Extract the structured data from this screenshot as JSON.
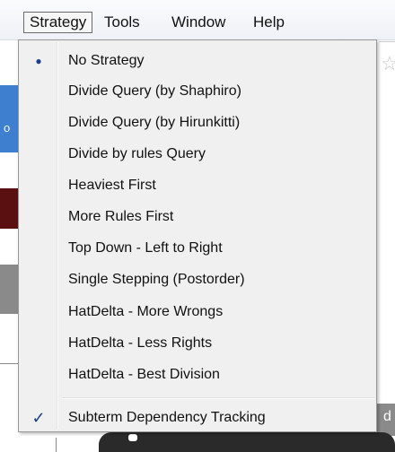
{
  "menubar": {
    "items": [
      {
        "label": "Strategy"
      },
      {
        "label": "Tools"
      },
      {
        "label": "Window"
      },
      {
        "label": "Help"
      }
    ]
  },
  "background": {
    "left_fragment_text": "o",
    "right_fragment_text": "d"
  },
  "strategy_menu": {
    "items": [
      {
        "label": "No Strategy",
        "state": "radio-selected",
        "icon": "bullet-icon",
        "glyph": "●"
      },
      {
        "label": "Divide  Query (by Shaphiro)"
      },
      {
        "label": "Divide  Query (by Hirunkitti)"
      },
      {
        "label": "Divide by rules  Query"
      },
      {
        "label": "Heaviest First"
      },
      {
        "label": "More Rules First"
      },
      {
        "label": "Top Down - Left to Right"
      },
      {
        "label": "Single Stepping (Postorder)"
      },
      {
        "label": "HatDelta - More Wrongs"
      },
      {
        "label": "HatDelta - Less Rights"
      },
      {
        "label": "HatDelta - Best Division"
      },
      {
        "label": "Subterm Dependency Tracking",
        "state": "checked",
        "icon": "check-icon",
        "glyph": "✓"
      }
    ]
  },
  "colors": {
    "menu_background": "#f0f0f0",
    "menu_border": "#979797",
    "mark_color": "#1c3f86"
  }
}
